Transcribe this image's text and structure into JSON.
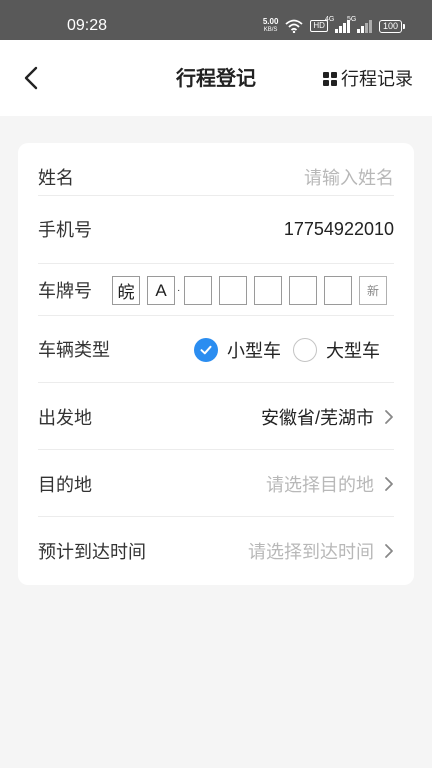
{
  "status_bar": {
    "time": "09:28",
    "speed_value": "5.00",
    "speed_unit": "KB/S",
    "hd_label": "HD",
    "signal1_label": "4G",
    "signal2_label": "5G",
    "battery": "100",
    "icons": [
      "wifi-icon",
      "signal-icon",
      "battery-icon"
    ]
  },
  "nav": {
    "back_icon": "chevron-left-icon",
    "title": "行程登记",
    "records_icon": "grid-icon",
    "records_label": "行程记录"
  },
  "form": {
    "name": {
      "label": "姓名",
      "placeholder": "请输入姓名",
      "value": ""
    },
    "phone": {
      "label": "手机号",
      "value": "17754922010"
    },
    "plate": {
      "label": "车牌号",
      "province": "皖",
      "city_letter": "A",
      "separator": "·",
      "digits": [
        "",
        "",
        "",
        "",
        ""
      ],
      "new_energy_label": "新"
    },
    "vehicle_type": {
      "label": "车辆类型",
      "options": [
        {
          "label": "小型车",
          "selected": true
        },
        {
          "label": "大型车",
          "selected": false
        }
      ],
      "accent_color": "#2b8df0"
    },
    "departure": {
      "label": "出发地",
      "value": "安徽省/芜湖市"
    },
    "destination": {
      "label": "目的地",
      "placeholder": "请选择目的地"
    },
    "arrival_time": {
      "label": "预计到达时间",
      "placeholder": "请选择到达时间"
    }
  }
}
